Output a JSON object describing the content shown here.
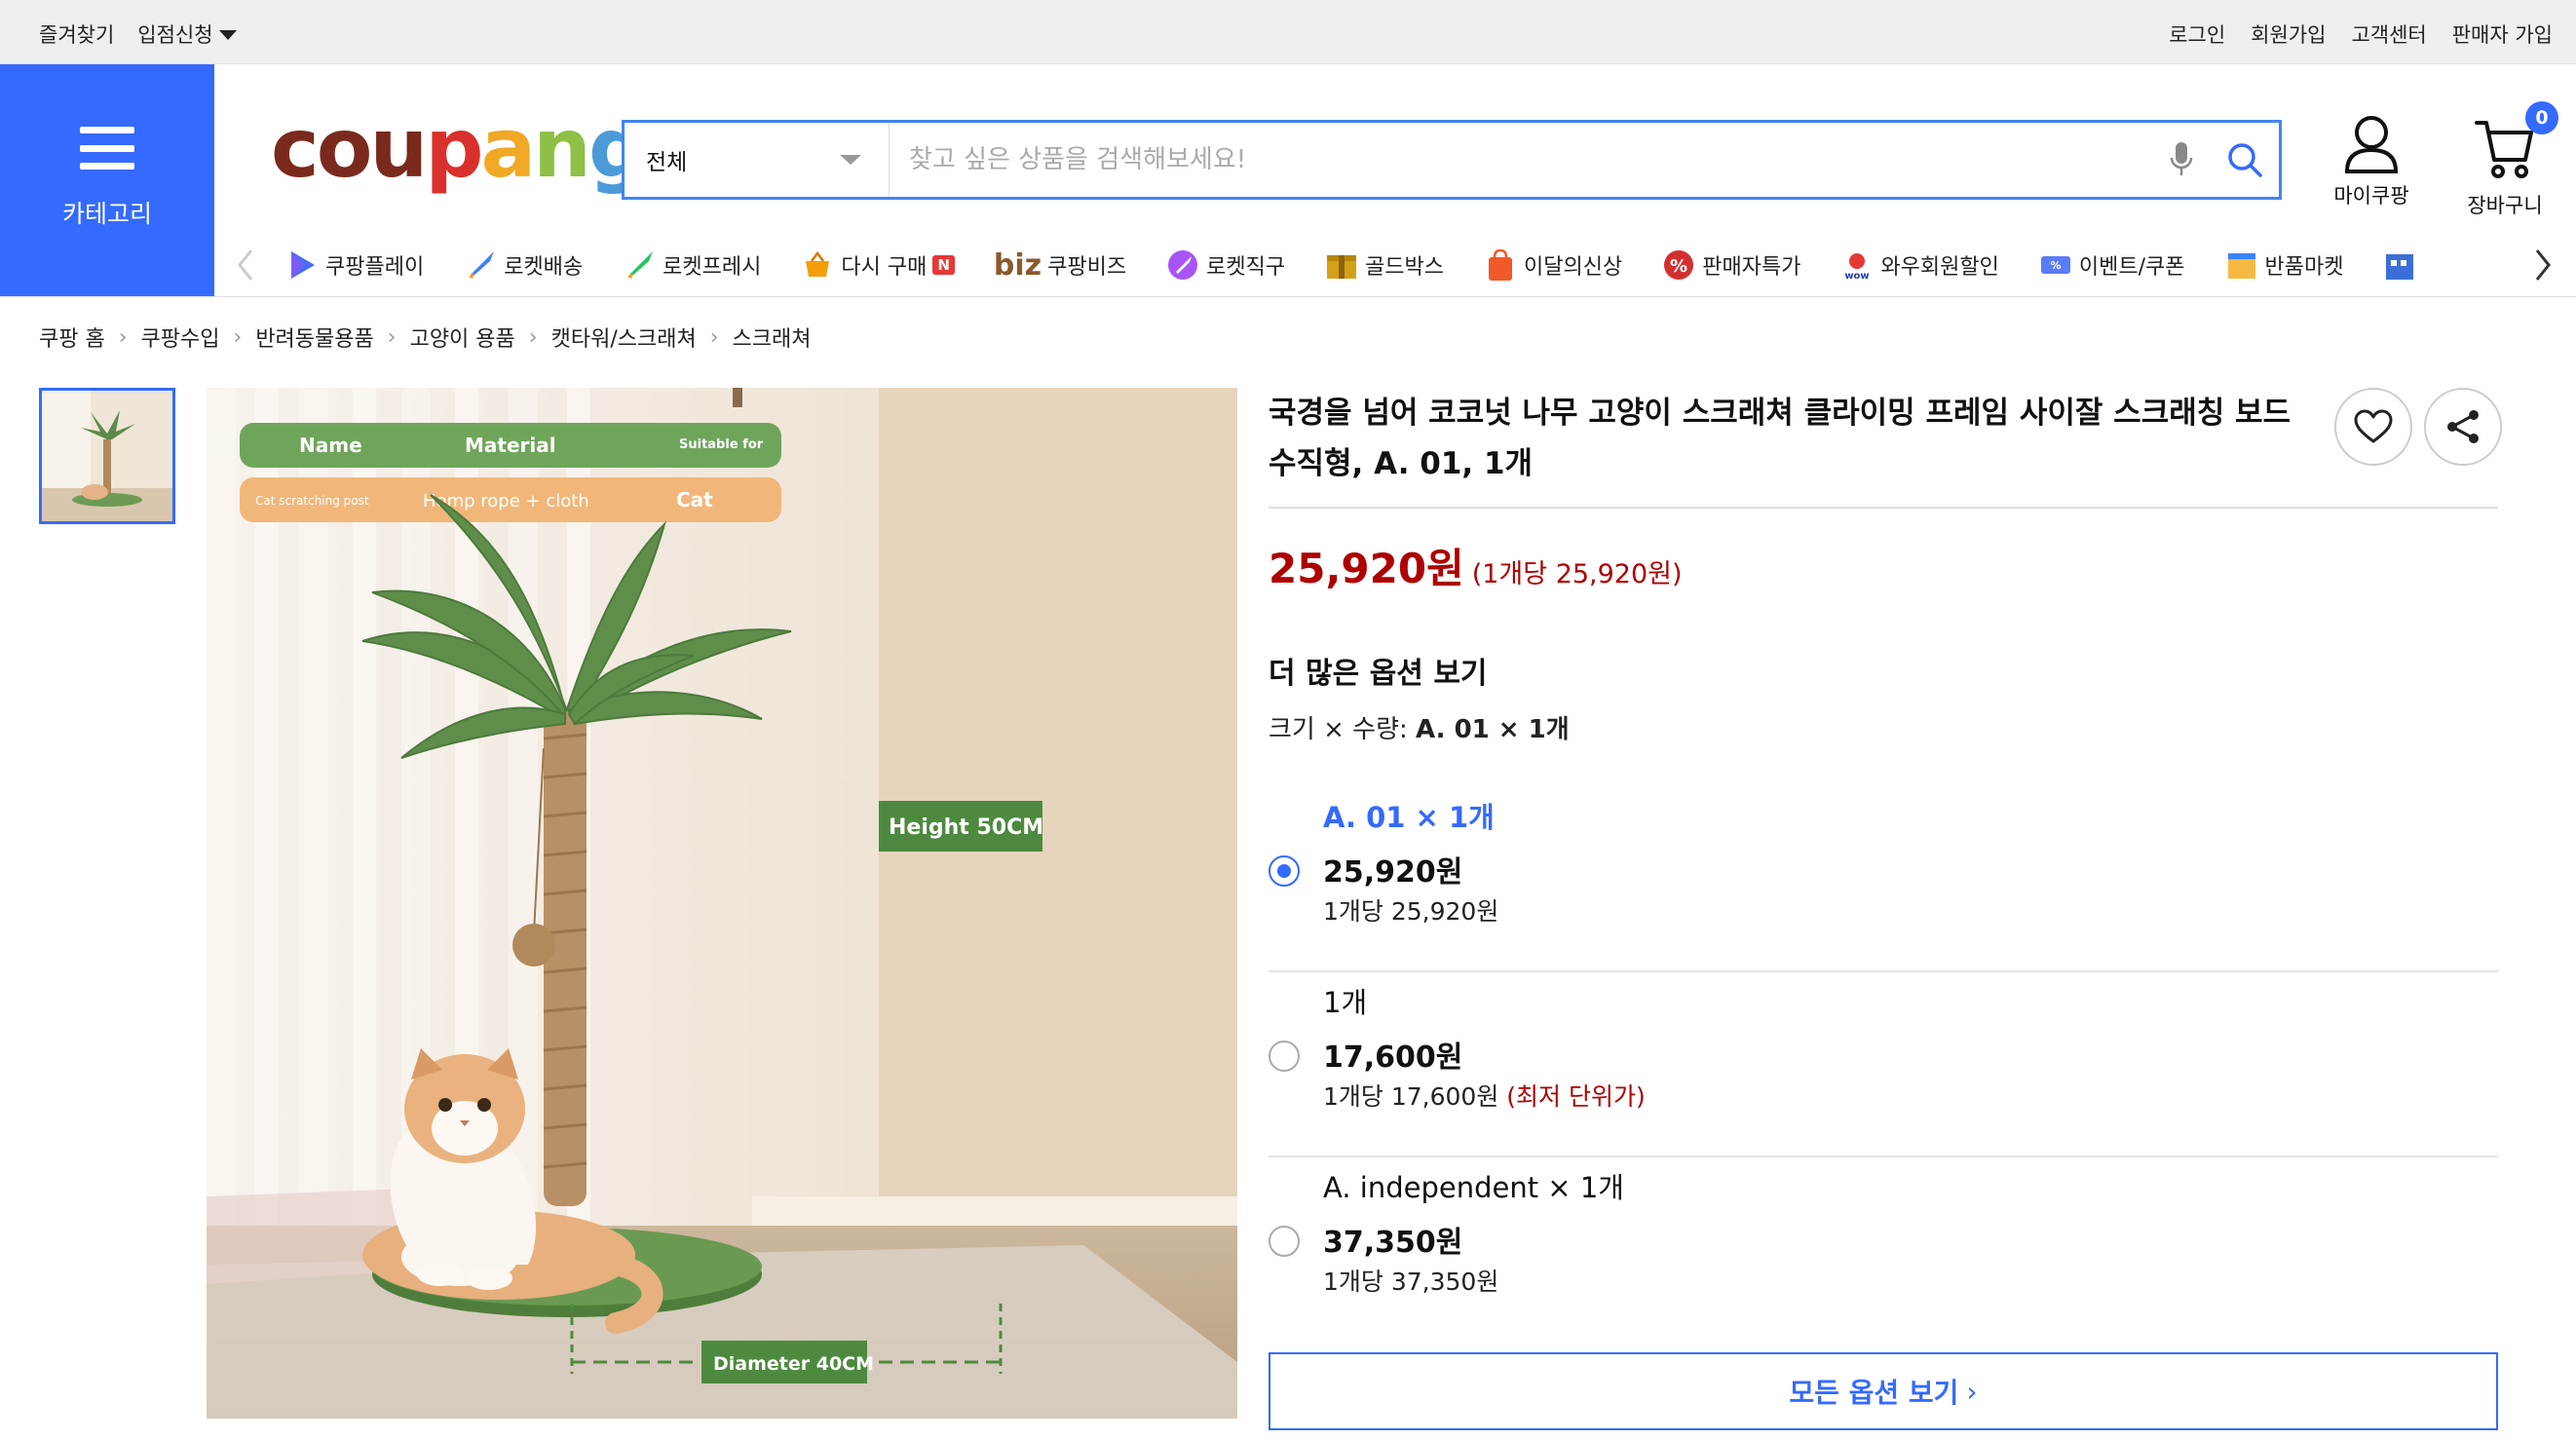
{
  "util_bar": {
    "left": [
      "즐겨찾기",
      "입점신청"
    ],
    "right": [
      "로그인",
      "회원가입",
      "고객센터",
      "판매자 가입"
    ]
  },
  "header": {
    "category_label": "카테고리",
    "logo_letters": [
      "c",
      "o",
      "u",
      "p",
      "a",
      "n",
      "g"
    ],
    "search_category": "전체",
    "search_placeholder": "찾고 싶은 상품을 검색해보세요!",
    "mycoupang_label": "마이쿠팡",
    "cart_label": "장바구니",
    "cart_count": "0"
  },
  "cat_strip": [
    {
      "label": "쿠팡플레이",
      "icon": "play-icon"
    },
    {
      "label": "로켓배송",
      "icon": "rocket-icon"
    },
    {
      "label": "로켓프레시",
      "icon": "rocket-fresh-icon"
    },
    {
      "label": "다시 구매",
      "icon": "basket-icon",
      "badge": "N"
    },
    {
      "label": "쿠팡비즈",
      "icon": "biz-icon",
      "prefix": "biz"
    },
    {
      "label": "로켓직구",
      "icon": "rocket-global-icon"
    },
    {
      "label": "골드박스",
      "icon": "goldbox-icon"
    },
    {
      "label": "이달의신상",
      "icon": "new-bag-icon"
    },
    {
      "label": "판매자특가",
      "icon": "percent-icon"
    },
    {
      "label": "와우회원할인",
      "icon": "wow-icon"
    },
    {
      "label": "이벤트/쿠폰",
      "icon": "coupon-icon"
    },
    {
      "label": "반품마켓",
      "icon": "return-market-icon"
    }
  ],
  "breadcrumb": [
    "쿠팡 홈",
    "쿠팡수입",
    "반려동물용품",
    "고양이 용품",
    "캣타워/스크래쳐",
    "스크래쳐"
  ],
  "image": {
    "table_headers": [
      "Name",
      "Material",
      "Suitable for"
    ],
    "table_values": [
      "Cat scratching post",
      "Hemp rope + cloth",
      "Cat"
    ],
    "height_label": "Height 50CM",
    "diameter_label": "Diameter 40CM"
  },
  "product": {
    "title": "국경을 넘어 코코넛 나무 고양이 스크래쳐 클라이밍 프레임 사이잘 스크래칭 보드 수직형, A. 01, 1개",
    "price": "25,920원",
    "unit_price": "(1개당 25,920원)",
    "more_options_heading": "더 많은 옵션 보기",
    "size_qty_label": "크기 × 수량:",
    "size_qty_value": "A. 01 × 1개",
    "options": [
      {
        "name": "A. 01 × 1개",
        "price": "25,920원",
        "unit": "1개당 25,920원",
        "note": "",
        "selected": true
      },
      {
        "name": "1개",
        "price": "17,600원",
        "unit": "1개당 17,600원",
        "note": "(최저 단위가)",
        "selected": false
      },
      {
        "name": "A. independent × 1개",
        "price": "37,350원",
        "unit": "1개당 37,350원",
        "note": "",
        "selected": false
      }
    ],
    "all_options_label": "모든 옵션 보기"
  },
  "colors": {
    "accent": "#346aff",
    "price_red": "#ae0000"
  }
}
